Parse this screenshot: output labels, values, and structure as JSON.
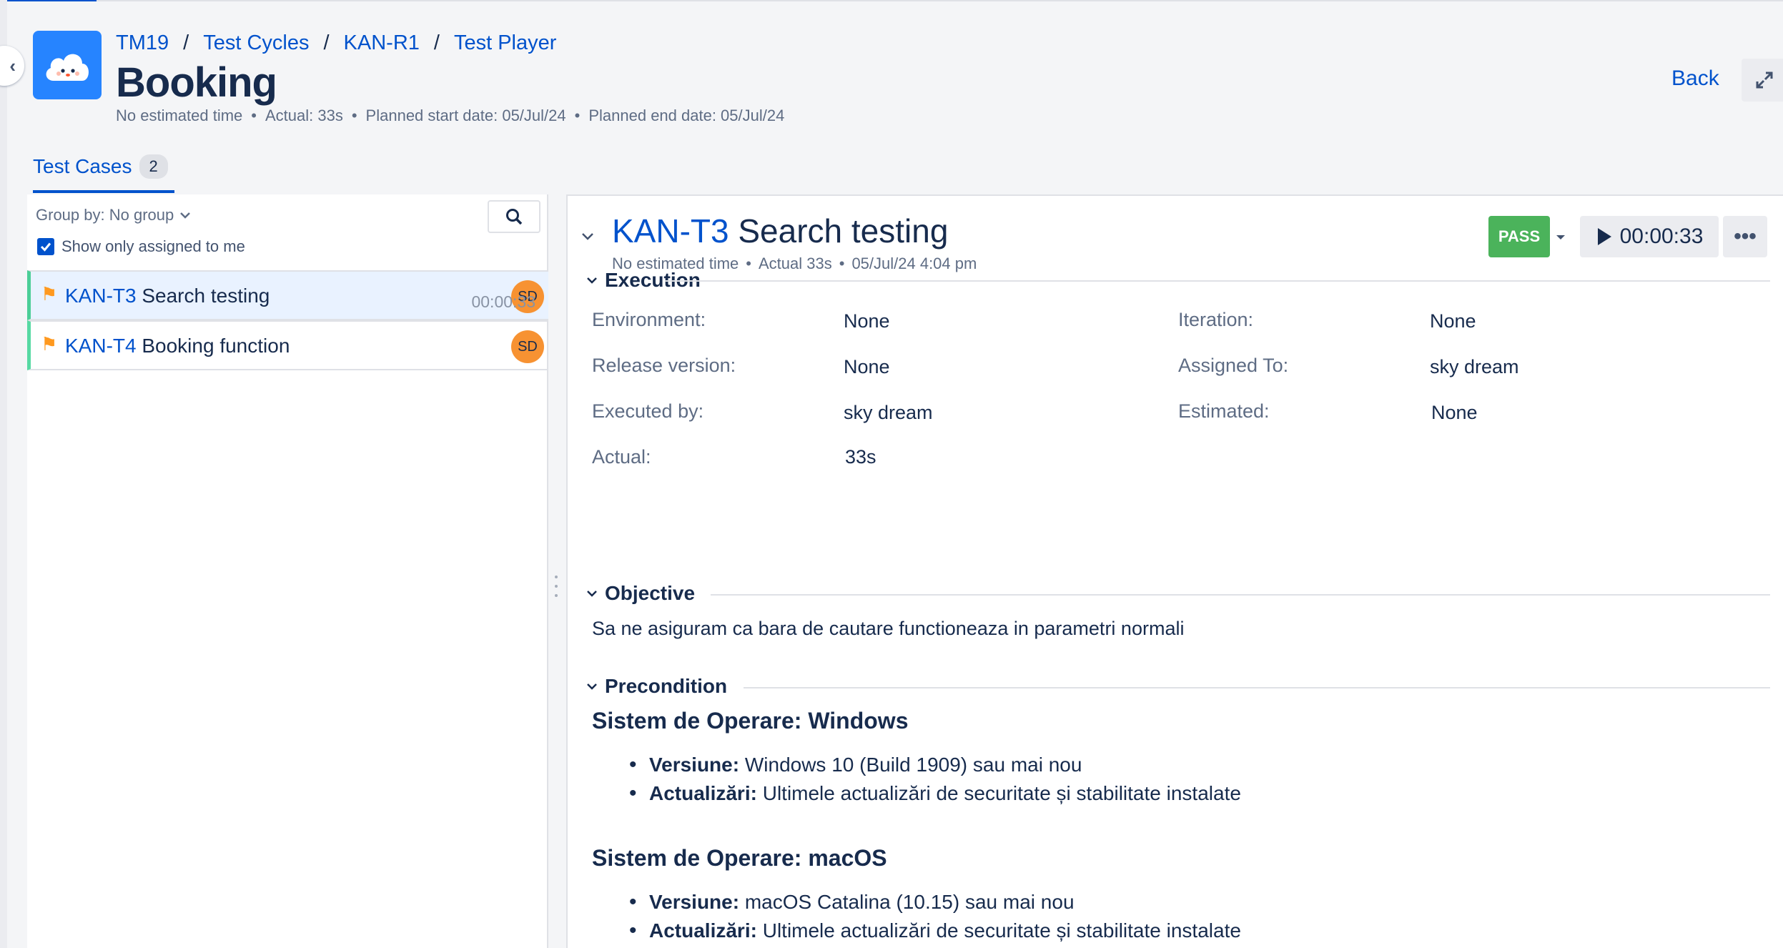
{
  "breadcrumb": [
    "TM19",
    "Test Cycles",
    "KAN-R1",
    "Test Player"
  ],
  "breadcrumb_separator": "/",
  "page_title": "Booking",
  "cycle_meta": {
    "estimate": "No estimated time",
    "actual": "Actual: 33s",
    "planned_start": "Planned start date: 05/Jul/24",
    "planned_end": "Planned end date: 05/Jul/24"
  },
  "header_actions": {
    "back_label": "Back"
  },
  "tabs": [
    {
      "label": "Test Cases",
      "count": "2"
    }
  ],
  "left_panel": {
    "group_by_label": "Group by: No group",
    "show_assigned_label": "Show only assigned to me",
    "show_assigned_checked": true,
    "cases": [
      {
        "key": "KAN-T3",
        "name": "Search testing",
        "avatar": "SD",
        "time": "00:00:33",
        "selected": true
      },
      {
        "key": "KAN-T4",
        "name": "Booking function",
        "avatar": "SD",
        "time": "",
        "selected": false
      }
    ]
  },
  "case_detail": {
    "key": "KAN-T3",
    "name": "Search testing",
    "meta": {
      "estimate": "No estimated time",
      "actual": "Actual 33s",
      "datetime": "05/Jul/24 4:04 pm"
    },
    "status_label": "PASS",
    "status_color": "#4bb35b",
    "timer": "00:00:33",
    "more_label": "•••",
    "execution": {
      "heading": "Execution",
      "fields": [
        {
          "label": "Environment:",
          "value": "None"
        },
        {
          "label": "Iteration:",
          "value": "None"
        },
        {
          "label": "Release version:",
          "value": "None"
        },
        {
          "label": "Assigned To:",
          "value": "sky dream"
        },
        {
          "label": "Executed by:",
          "value": "sky dream"
        },
        {
          "label": "Estimated:",
          "value": "None"
        },
        {
          "label": "Actual:",
          "value": "33s"
        }
      ]
    },
    "objective": {
      "heading": "Objective",
      "text": "Sa ne asiguram ca bara de cautare functioneaza in parametri normali"
    },
    "precondition": {
      "heading": "Precondition",
      "groups": [
        {
          "title": "Sistem de Operare: Windows",
          "items": [
            {
              "label": "Versiune:",
              "text": "Windows 10 (Build 1909) sau mai nou"
            },
            {
              "label": "Actualizări:",
              "text": "Ultimele actualizări de securitate și stabilitate instalate"
            }
          ]
        },
        {
          "title": "Sistem de Operare: macOS",
          "items": [
            {
              "label": "Versiune:",
              "text": "macOS Catalina (10.15) sau mai nou"
            },
            {
              "label": "Actualizări:",
              "text": "Ultimele actualizări de securitate și stabilitate instalate"
            }
          ]
        }
      ]
    }
  },
  "colors": {
    "accent": "#0052cc",
    "pass": "#4bb35b",
    "avatar": "#f79232",
    "flag": "#ff991f",
    "status_bar": "#57d9a3"
  },
  "icons": {
    "collapse_sidebar": "chevron-left-icon",
    "logo": "cloud-logo-icon",
    "expand": "expand-icon",
    "search": "search-icon",
    "flag": "flag-icon",
    "play": "play-icon",
    "section_toggle": "chevron-down-icon"
  }
}
